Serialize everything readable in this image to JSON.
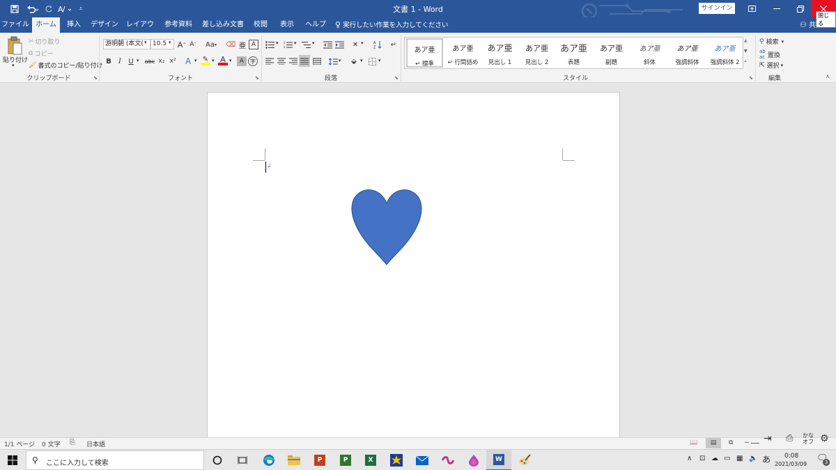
{
  "titlebar": {
    "title": "文書 1  -  Word",
    "signin_label": "サインイン",
    "close_tooltip": "閉じる"
  },
  "tabs": [
    {
      "label": "ファイル"
    },
    {
      "label": "ホーム"
    },
    {
      "label": "挿入"
    },
    {
      "label": "デザイン"
    },
    {
      "label": "レイアウト"
    },
    {
      "label": "参考資料"
    },
    {
      "label": "差し込み文書"
    },
    {
      "label": "校閲"
    },
    {
      "label": "表示"
    },
    {
      "label": "ヘルプ"
    }
  ],
  "tell_me": "実行したい作業を入力してください",
  "share_label": "共有",
  "ribbon": {
    "clipboard": {
      "paste_label": "貼り付け",
      "cut_label": "切り取り",
      "copy_label": "コピー",
      "format_painter_label": "書式のコピー/貼り付け",
      "group_label": "クリップボード"
    },
    "font": {
      "font_name": "游明朝 (本文(",
      "font_size": "10.5",
      "group_label": "フォント",
      "bold": "B",
      "italic": "I",
      "underline": "U",
      "strike": "abc",
      "subscript": "x₂",
      "superscript": "x²",
      "case": "Aa",
      "grow": "A",
      "shrink": "A",
      "font_color_letter": "A",
      "text_effect_letter": "A",
      "char_shade_letter": "A",
      "enclose_letter": "字",
      "ruby_letter": "亜",
      "border_letter": "A"
    },
    "paragraph": {
      "group_label": "段落"
    },
    "styles": {
      "group_label": "スタイル",
      "items": [
        {
          "preview": "あア亜",
          "name": "↵ 標準"
        },
        {
          "preview": "あア亜",
          "name": "↵ 行間詰め"
        },
        {
          "preview": "あア亜",
          "name": "見出し 1"
        },
        {
          "preview": "あア亜",
          "name": "見出し 2"
        },
        {
          "preview": "あア亜",
          "name": "表題"
        },
        {
          "preview": "あア亜",
          "name": "副題"
        },
        {
          "preview": "あア亜",
          "name": "斜体"
        },
        {
          "preview": "あア亜",
          "name": "強調斜体"
        },
        {
          "preview": "あア亜",
          "name": "強調斜体 2"
        }
      ]
    },
    "editing": {
      "search_label": "検索",
      "replace_label": "置換",
      "select_label": "選択",
      "group_label": "編集"
    }
  },
  "document": {
    "shape": "heart",
    "shape_color": "#4472c4",
    "shape_outline": "#2f528f"
  },
  "statusbar": {
    "page": "1/1 ページ",
    "words": "0 文字",
    "language": "日本語"
  },
  "taskbar": {
    "search_placeholder": "ここに入力して検索",
    "ime_label": "あ",
    "kana_line1": "かな",
    "kana_line2": "オフ",
    "time": "0:08",
    "date": "2021/03/09",
    "notification_count": "3"
  },
  "colors": {
    "word_blue": "#2b579a",
    "ribbon_bg": "#f3f3f3",
    "close_red": "#e81123"
  }
}
